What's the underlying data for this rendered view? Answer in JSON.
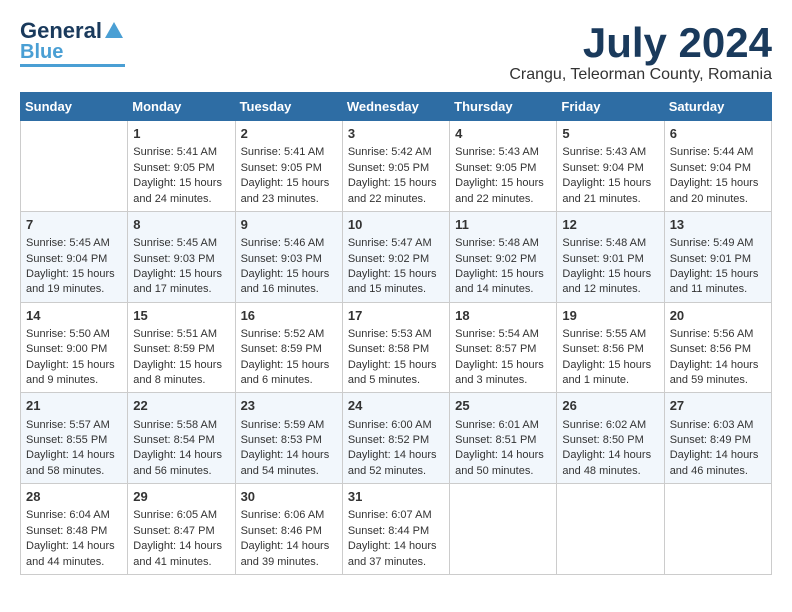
{
  "logo": {
    "general": "General",
    "blue": "Blue"
  },
  "title": "July 2024",
  "location": "Crangu, Teleorman County, Romania",
  "days_of_week": [
    "Sunday",
    "Monday",
    "Tuesday",
    "Wednesday",
    "Thursday",
    "Friday",
    "Saturday"
  ],
  "weeks": [
    [
      {
        "day": "",
        "info": ""
      },
      {
        "day": "1",
        "info": "Sunrise: 5:41 AM\nSunset: 9:05 PM\nDaylight: 15 hours\nand 24 minutes."
      },
      {
        "day": "2",
        "info": "Sunrise: 5:41 AM\nSunset: 9:05 PM\nDaylight: 15 hours\nand 23 minutes."
      },
      {
        "day": "3",
        "info": "Sunrise: 5:42 AM\nSunset: 9:05 PM\nDaylight: 15 hours\nand 22 minutes."
      },
      {
        "day": "4",
        "info": "Sunrise: 5:43 AM\nSunset: 9:05 PM\nDaylight: 15 hours\nand 22 minutes."
      },
      {
        "day": "5",
        "info": "Sunrise: 5:43 AM\nSunset: 9:04 PM\nDaylight: 15 hours\nand 21 minutes."
      },
      {
        "day": "6",
        "info": "Sunrise: 5:44 AM\nSunset: 9:04 PM\nDaylight: 15 hours\nand 20 minutes."
      }
    ],
    [
      {
        "day": "7",
        "info": "Sunrise: 5:45 AM\nSunset: 9:04 PM\nDaylight: 15 hours\nand 19 minutes."
      },
      {
        "day": "8",
        "info": "Sunrise: 5:45 AM\nSunset: 9:03 PM\nDaylight: 15 hours\nand 17 minutes."
      },
      {
        "day": "9",
        "info": "Sunrise: 5:46 AM\nSunset: 9:03 PM\nDaylight: 15 hours\nand 16 minutes."
      },
      {
        "day": "10",
        "info": "Sunrise: 5:47 AM\nSunset: 9:02 PM\nDaylight: 15 hours\nand 15 minutes."
      },
      {
        "day": "11",
        "info": "Sunrise: 5:48 AM\nSunset: 9:02 PM\nDaylight: 15 hours\nand 14 minutes."
      },
      {
        "day": "12",
        "info": "Sunrise: 5:48 AM\nSunset: 9:01 PM\nDaylight: 15 hours\nand 12 minutes."
      },
      {
        "day": "13",
        "info": "Sunrise: 5:49 AM\nSunset: 9:01 PM\nDaylight: 15 hours\nand 11 minutes."
      }
    ],
    [
      {
        "day": "14",
        "info": "Sunrise: 5:50 AM\nSunset: 9:00 PM\nDaylight: 15 hours\nand 9 minutes."
      },
      {
        "day": "15",
        "info": "Sunrise: 5:51 AM\nSunset: 8:59 PM\nDaylight: 15 hours\nand 8 minutes."
      },
      {
        "day": "16",
        "info": "Sunrise: 5:52 AM\nSunset: 8:59 PM\nDaylight: 15 hours\nand 6 minutes."
      },
      {
        "day": "17",
        "info": "Sunrise: 5:53 AM\nSunset: 8:58 PM\nDaylight: 15 hours\nand 5 minutes."
      },
      {
        "day": "18",
        "info": "Sunrise: 5:54 AM\nSunset: 8:57 PM\nDaylight: 15 hours\nand 3 minutes."
      },
      {
        "day": "19",
        "info": "Sunrise: 5:55 AM\nSunset: 8:56 PM\nDaylight: 15 hours\nand 1 minute."
      },
      {
        "day": "20",
        "info": "Sunrise: 5:56 AM\nSunset: 8:56 PM\nDaylight: 14 hours\nand 59 minutes."
      }
    ],
    [
      {
        "day": "21",
        "info": "Sunrise: 5:57 AM\nSunset: 8:55 PM\nDaylight: 14 hours\nand 58 minutes."
      },
      {
        "day": "22",
        "info": "Sunrise: 5:58 AM\nSunset: 8:54 PM\nDaylight: 14 hours\nand 56 minutes."
      },
      {
        "day": "23",
        "info": "Sunrise: 5:59 AM\nSunset: 8:53 PM\nDaylight: 14 hours\nand 54 minutes."
      },
      {
        "day": "24",
        "info": "Sunrise: 6:00 AM\nSunset: 8:52 PM\nDaylight: 14 hours\nand 52 minutes."
      },
      {
        "day": "25",
        "info": "Sunrise: 6:01 AM\nSunset: 8:51 PM\nDaylight: 14 hours\nand 50 minutes."
      },
      {
        "day": "26",
        "info": "Sunrise: 6:02 AM\nSunset: 8:50 PM\nDaylight: 14 hours\nand 48 minutes."
      },
      {
        "day": "27",
        "info": "Sunrise: 6:03 AM\nSunset: 8:49 PM\nDaylight: 14 hours\nand 46 minutes."
      }
    ],
    [
      {
        "day": "28",
        "info": "Sunrise: 6:04 AM\nSunset: 8:48 PM\nDaylight: 14 hours\nand 44 minutes."
      },
      {
        "day": "29",
        "info": "Sunrise: 6:05 AM\nSunset: 8:47 PM\nDaylight: 14 hours\nand 41 minutes."
      },
      {
        "day": "30",
        "info": "Sunrise: 6:06 AM\nSunset: 8:46 PM\nDaylight: 14 hours\nand 39 minutes."
      },
      {
        "day": "31",
        "info": "Sunrise: 6:07 AM\nSunset: 8:44 PM\nDaylight: 14 hours\nand 37 minutes."
      },
      {
        "day": "",
        "info": ""
      },
      {
        "day": "",
        "info": ""
      },
      {
        "day": "",
        "info": ""
      }
    ]
  ]
}
